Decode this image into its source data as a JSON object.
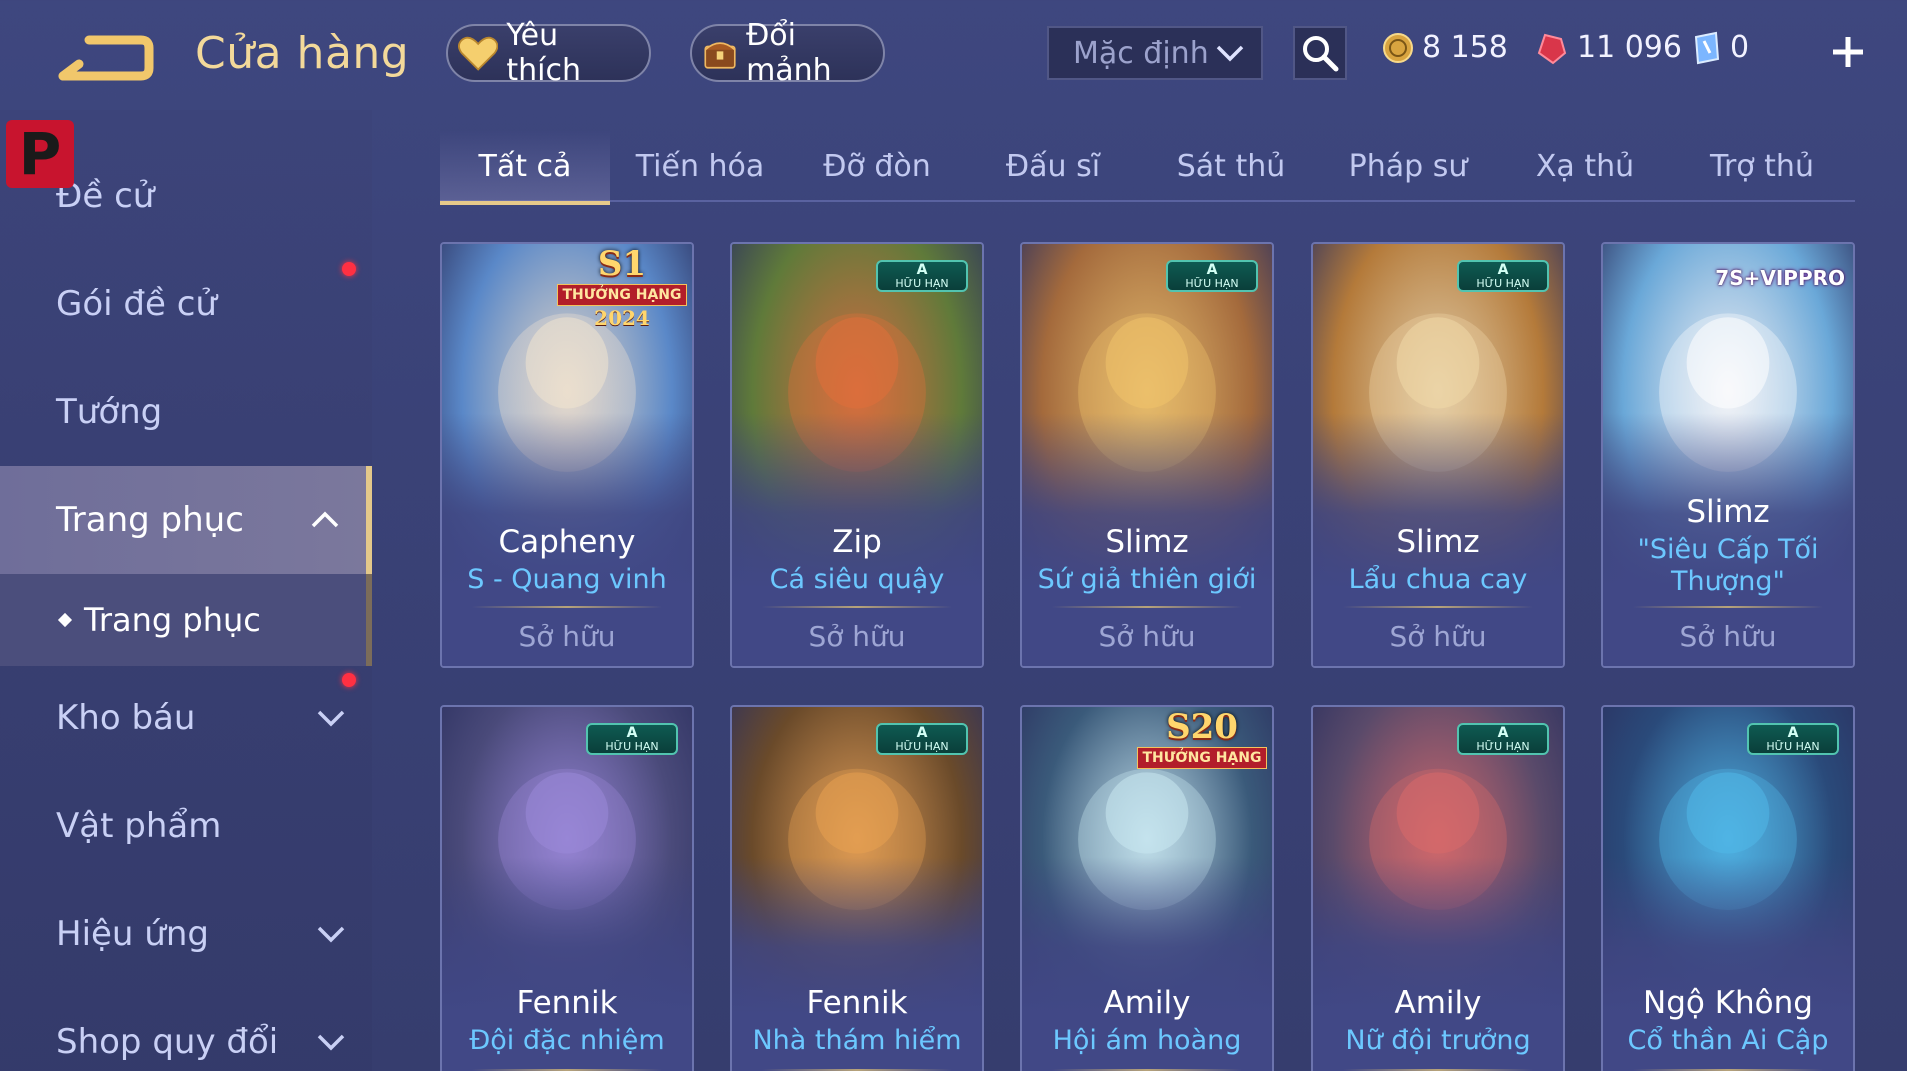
{
  "header": {
    "title": "Cửa hàng",
    "favorite_label": "Yêu thích",
    "exchange_label": "Đổi mảnh",
    "sort_label": "Mặc định"
  },
  "currencies": {
    "gold": "8 158",
    "gems": "11 096",
    "vouchers": "0"
  },
  "sidebar": {
    "items": [
      {
        "label": "Đề cử"
      },
      {
        "label": "Gói đề cử"
      },
      {
        "label": "Tướng"
      },
      {
        "label": "Trang phục"
      },
      {
        "label": "Trang phục"
      },
      {
        "label": "Kho báu"
      },
      {
        "label": "Vật phẩm"
      },
      {
        "label": "Hiệu ứng"
      },
      {
        "label": "Shop quy đổi"
      }
    ]
  },
  "tabs": [
    {
      "label": "Tất cả"
    },
    {
      "label": "Tiến hóa"
    },
    {
      "label": "Đỡ đòn"
    },
    {
      "label": "Đấu sĩ"
    },
    {
      "label": "Sát thủ"
    },
    {
      "label": "Pháp sư"
    },
    {
      "label": "Xạ thủ"
    },
    {
      "label": "Trợ thủ"
    }
  ],
  "badges": {
    "limited_a": "A",
    "limited_text": "HỮU HẠN",
    "s1_big": "S1",
    "s1_strip": "THƯỞNG HẠNG",
    "s1_year": "2024",
    "s20_big": "S20",
    "s20_strip": "THƯỞNG HẠNG",
    "vip": "7S+VIPPRO"
  },
  "cards_row1": [
    {
      "hero": "Capheny",
      "skin": "S - Quang vinh",
      "status": "Sở hữu",
      "bg": "#5a88c8",
      "accent": "#f0e3d0"
    },
    {
      "hero": "Zip",
      "skin": "Cá siêu quậy",
      "status": "Sở hữu",
      "bg": "#5f7a3a",
      "accent": "#e0703a"
    },
    {
      "hero": "Slimz",
      "skin": "Sứ giả thiên giới",
      "status": "Sở hữu",
      "bg": "#a46a3c",
      "accent": "#f1c36a"
    },
    {
      "hero": "Slimz",
      "skin": "Lẩu chua cay",
      "status": "Sở hữu",
      "bg": "#b47a3a",
      "accent": "#f0d8a8"
    },
    {
      "hero": "Slimz",
      "skin": "\"Siêu Cấp Tối Thượng\"",
      "status": "Sở hữu",
      "bg": "#6aa8d8",
      "accent": "#ffffff"
    }
  ],
  "cards_row2": [
    {
      "hero": "Fennik",
      "skin": "Đội đặc nhiệm",
      "bg": "#4a4a7a",
      "accent": "#9a88d8"
    },
    {
      "hero": "Fennik",
      "skin": "Nhà thám hiểm",
      "bg": "#6a4a2a",
      "accent": "#e8a050"
    },
    {
      "hero": "Amily",
      "skin": "Hội ám hoàng",
      "bg": "#3a5a7a",
      "accent": "#c8e8f0"
    },
    {
      "hero": "Amily",
      "skin": "Nữ đội trưởng",
      "bg": "#5a4a6a",
      "accent": "#d86a6a"
    },
    {
      "hero": "Ngộ Không",
      "skin": "Cổ thần Ai Cập",
      "bg": "#2a4a7a",
      "accent": "#50b8e8"
    }
  ]
}
